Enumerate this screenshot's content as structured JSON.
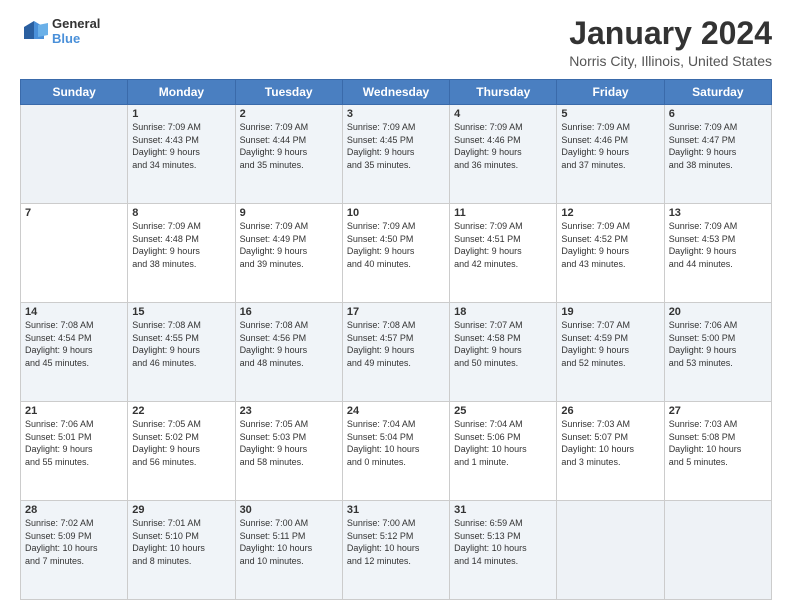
{
  "header": {
    "logo_line1": "General",
    "logo_line2": "Blue",
    "title": "January 2024",
    "subtitle": "Norris City, Illinois, United States"
  },
  "weekdays": [
    "Sunday",
    "Monday",
    "Tuesday",
    "Wednesday",
    "Thursday",
    "Friday",
    "Saturday"
  ],
  "weeks": [
    [
      {
        "day": "",
        "info": ""
      },
      {
        "day": "1",
        "info": "Sunrise: 7:09 AM\nSunset: 4:43 PM\nDaylight: 9 hours\nand 34 minutes."
      },
      {
        "day": "2",
        "info": "Sunrise: 7:09 AM\nSunset: 4:44 PM\nDaylight: 9 hours\nand 35 minutes."
      },
      {
        "day": "3",
        "info": "Sunrise: 7:09 AM\nSunset: 4:45 PM\nDaylight: 9 hours\nand 35 minutes."
      },
      {
        "day": "4",
        "info": "Sunrise: 7:09 AM\nSunset: 4:46 PM\nDaylight: 9 hours\nand 36 minutes."
      },
      {
        "day": "5",
        "info": "Sunrise: 7:09 AM\nSunset: 4:46 PM\nDaylight: 9 hours\nand 37 minutes."
      },
      {
        "day": "6",
        "info": "Sunrise: 7:09 AM\nSunset: 4:47 PM\nDaylight: 9 hours\nand 38 minutes."
      }
    ],
    [
      {
        "day": "7",
        "info": ""
      },
      {
        "day": "8",
        "info": "Sunrise: 7:09 AM\nSunset: 4:48 PM\nDaylight: 9 hours\nand 38 minutes."
      },
      {
        "day": "9",
        "info": "Sunrise: 7:09 AM\nSunset: 4:49 PM\nDaylight: 9 hours\nand 39 minutes."
      },
      {
        "day": "10",
        "info": "Sunrise: 7:09 AM\nSunset: 4:50 PM\nDaylight: 9 hours\nand 40 minutes."
      },
      {
        "day": "11",
        "info": "Sunrise: 7:09 AM\nSunset: 4:51 PM\nDaylight: 9 hours\nand 42 minutes."
      },
      {
        "day": "12",
        "info": "Sunrise: 7:09 AM\nSunset: 4:52 PM\nDaylight: 9 hours\nand 43 minutes."
      },
      {
        "day": "13",
        "info": "Sunrise: 7:09 AM\nSunset: 4:53 PM\nDaylight: 9 hours\nand 44 minutes."
      }
    ],
    [
      {
        "day": "14",
        "info": "Sunrise: 7:08 AM\nSunset: 4:54 PM\nDaylight: 9 hours\nand 45 minutes."
      },
      {
        "day": "15",
        "info": "Sunrise: 7:08 AM\nSunset: 4:55 PM\nDaylight: 9 hours\nand 46 minutes."
      },
      {
        "day": "16",
        "info": "Sunrise: 7:08 AM\nSunset: 4:56 PM\nDaylight: 9 hours\nand 48 minutes."
      },
      {
        "day": "17",
        "info": "Sunrise: 7:08 AM\nSunset: 4:57 PM\nDaylight: 9 hours\nand 49 minutes."
      },
      {
        "day": "18",
        "info": "Sunrise: 7:07 AM\nSunset: 4:58 PM\nDaylight: 9 hours\nand 50 minutes."
      },
      {
        "day": "19",
        "info": "Sunrise: 7:07 AM\nSunset: 4:59 PM\nDaylight: 9 hours\nand 52 minutes."
      },
      {
        "day": "20",
        "info": "Sunrise: 7:06 AM\nSunset: 5:00 PM\nDaylight: 9 hours\nand 53 minutes."
      }
    ],
    [
      {
        "day": "21",
        "info": "Sunrise: 7:06 AM\nSunset: 5:01 PM\nDaylight: 9 hours\nand 55 minutes."
      },
      {
        "day": "22",
        "info": "Sunrise: 7:05 AM\nSunset: 5:02 PM\nDaylight: 9 hours\nand 56 minutes."
      },
      {
        "day": "23",
        "info": "Sunrise: 7:05 AM\nSunset: 5:03 PM\nDaylight: 9 hours\nand 58 minutes."
      },
      {
        "day": "24",
        "info": "Sunrise: 7:04 AM\nSunset: 5:04 PM\nDaylight: 10 hours\nand 0 minutes."
      },
      {
        "day": "25",
        "info": "Sunrise: 7:04 AM\nSunset: 5:06 PM\nDaylight: 10 hours\nand 1 minute."
      },
      {
        "day": "26",
        "info": "Sunrise: 7:03 AM\nSunset: 5:07 PM\nDaylight: 10 hours\nand 3 minutes."
      },
      {
        "day": "27",
        "info": "Sunrise: 7:03 AM\nSunset: 5:08 PM\nDaylight: 10 hours\nand 5 minutes."
      }
    ],
    [
      {
        "day": "28",
        "info": "Sunrise: 7:02 AM\nSunset: 5:09 PM\nDaylight: 10 hours\nand 7 minutes."
      },
      {
        "day": "29",
        "info": "Sunrise: 7:01 AM\nSunset: 5:10 PM\nDaylight: 10 hours\nand 8 minutes."
      },
      {
        "day": "30",
        "info": "Sunrise: 7:00 AM\nSunset: 5:11 PM\nDaylight: 10 hours\nand 10 minutes."
      },
      {
        "day": "31",
        "info": "Sunrise: 7:00 AM\nSunset: 5:12 PM\nDaylight: 10 hours\nand 12 minutes."
      },
      {
        "day": "",
        "info": "Sunrise: 6:59 AM\nSunset: 5:13 PM\nDaylight: 10 hours\nand 14 minutes."
      },
      {
        "day": "",
        "info": ""
      },
      {
        "day": "",
        "info": ""
      }
    ]
  ]
}
